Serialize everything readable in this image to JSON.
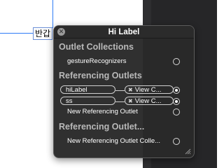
{
  "canvas": {
    "label_text": "반갑"
  },
  "hud": {
    "title": "Hi Label",
    "outlet_collections": {
      "header": "Outlet Collections",
      "items": [
        {
          "label": "gestureRecognizers"
        }
      ]
    },
    "referencing_outlets": {
      "header": "Referencing Outlets",
      "connections": [
        {
          "name": "hiLabel",
          "target": "View C..."
        },
        {
          "name": "ss",
          "target": "View C..."
        }
      ],
      "new_label": "New Referencing Outlet"
    },
    "referencing_outlet_collections": {
      "header": "Referencing Outlet...",
      "new_label": "New Referencing Outlet Colle..."
    }
  }
}
